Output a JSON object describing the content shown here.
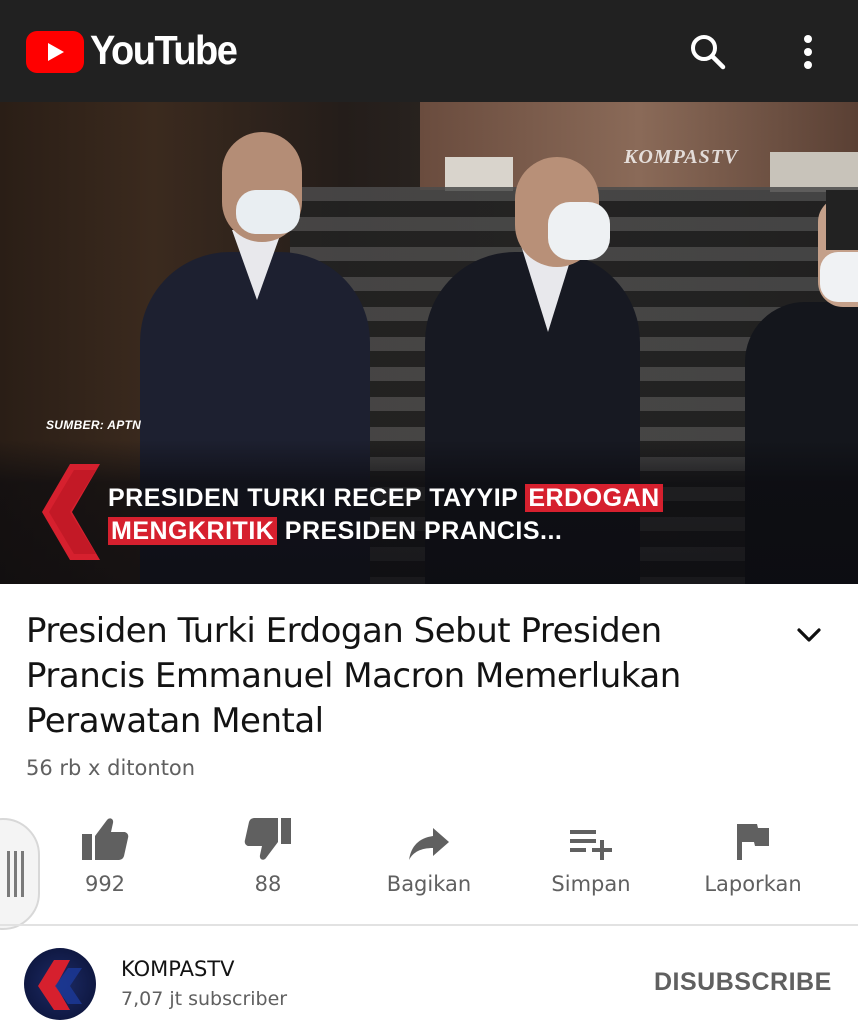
{
  "header": {
    "logo_text": "YouTube",
    "search_icon": "search-icon",
    "more_icon": "more-vert-icon",
    "background": "#212121",
    "brand_red": "#ff0000"
  },
  "video": {
    "watermark": "KOMPASTV",
    "source": "SUMBER: APTN",
    "caption_line1_plain": "PRESIDEN TURKI RECEP TAYYIP ",
    "caption_line1_highlight": "ERDOGAN",
    "caption_line2_highlight": "MENGKRITIK",
    "caption_line2_plain": " PRESIDEN PRANCIS...",
    "highlight_color": "#d6202e"
  },
  "details": {
    "title": "Presiden Turki Erdogan Sebut Presiden Prancis Emmanuel Macron Memerlukan Perawatan Mental",
    "views": "56 rb x ditonton",
    "expand_icon": "chevron-down-icon"
  },
  "actions": [
    {
      "icon": "thumbs-up-icon",
      "label": "992"
    },
    {
      "icon": "thumbs-down-icon",
      "label": "88"
    },
    {
      "icon": "share-icon",
      "label": "Bagikan"
    },
    {
      "icon": "playlist-add-icon",
      "label": "Simpan"
    },
    {
      "icon": "flag-icon",
      "label": "Laporkan"
    }
  ],
  "channel": {
    "name": "KOMPASTV",
    "subscribers": "7,07 jt subscriber",
    "unsubscribe_label": "DISUBSCRIBE"
  }
}
